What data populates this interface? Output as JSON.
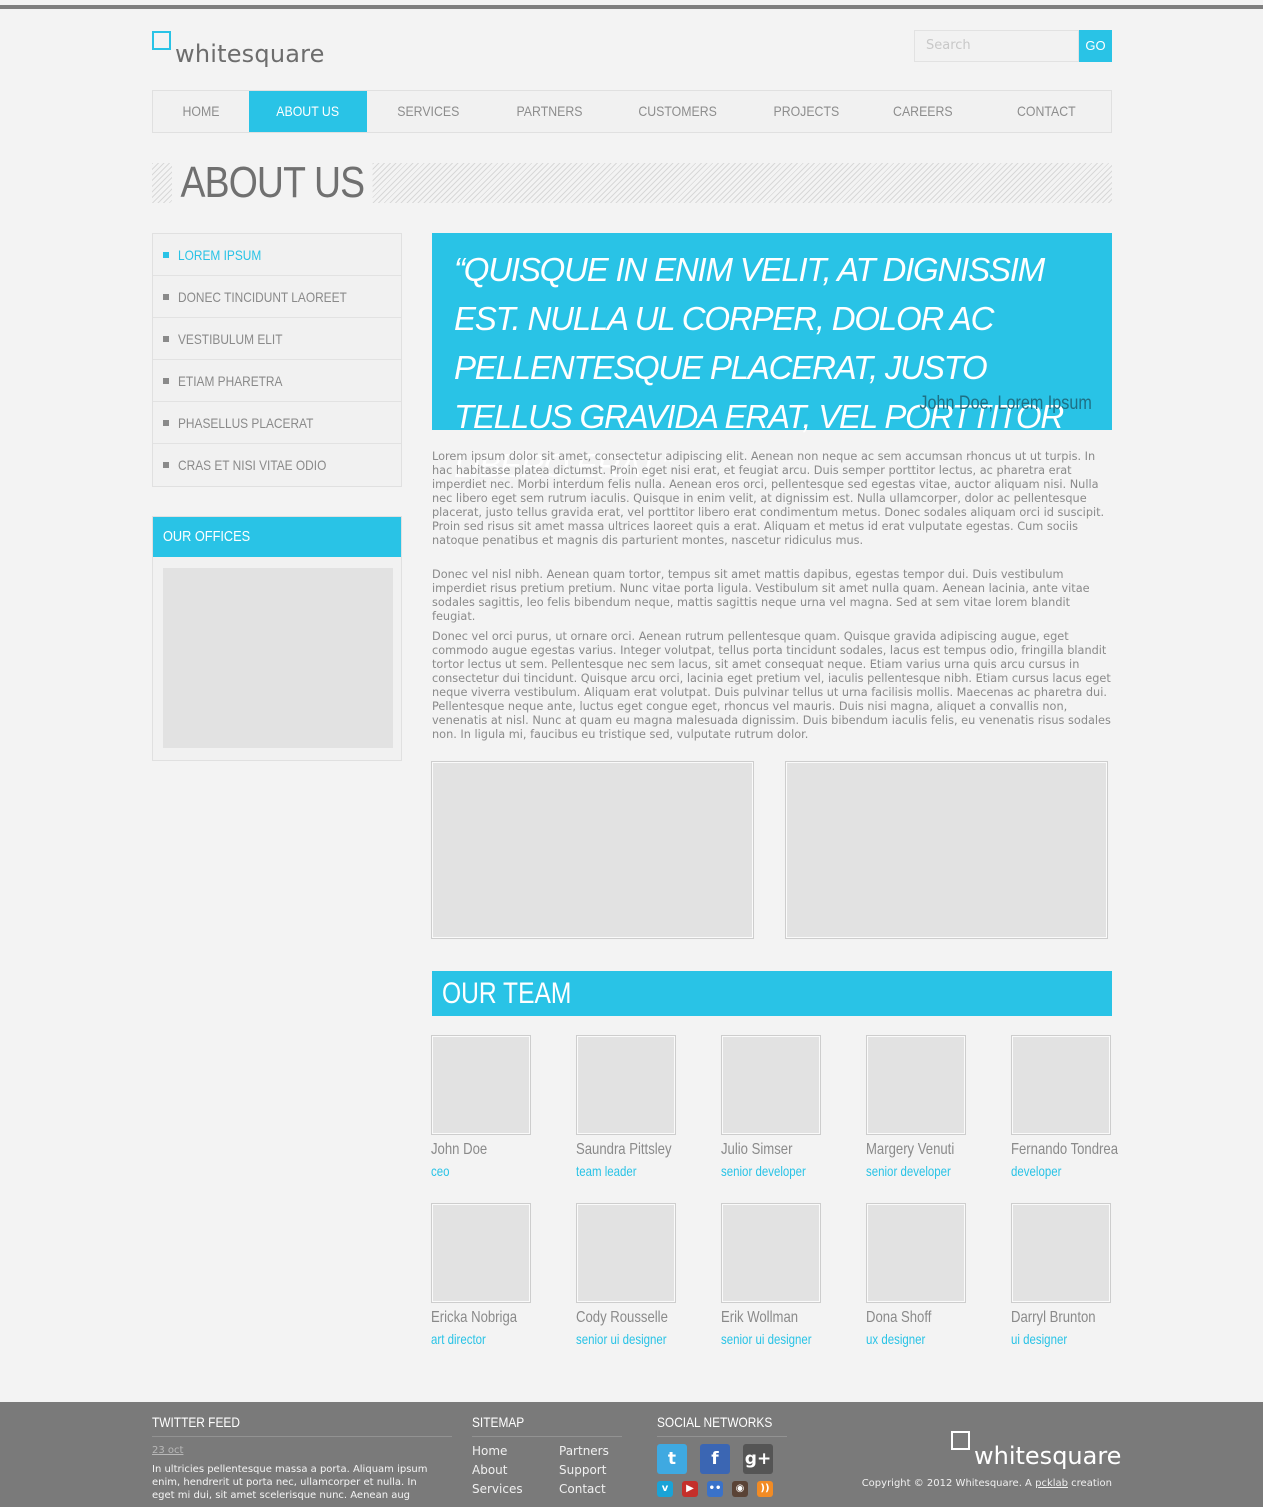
{
  "header": {
    "logo_text": "whitesquare",
    "search_placeholder": "Search",
    "search_button": "GO"
  },
  "nav": [
    {
      "label": "HOME",
      "active": false
    },
    {
      "label": "ABOUT US",
      "active": true
    },
    {
      "label": "SERVICES",
      "active": false
    },
    {
      "label": "PARTNERS",
      "active": false
    },
    {
      "label": "CUSTOMERS",
      "active": false
    },
    {
      "label": "PROJECTS",
      "active": false
    },
    {
      "label": "CAREERS",
      "active": false
    },
    {
      "label": "CONTACT",
      "active": false
    }
  ],
  "page_title": "ABOUT US",
  "sidebar": {
    "items": [
      {
        "label": "LOREM IPSUM",
        "active": true
      },
      {
        "label": "DONEC TINCIDUNT LAOREET",
        "active": false
      },
      {
        "label": "VESTIBULUM ELIT",
        "active": false
      },
      {
        "label": "ETIAM PHARETRA",
        "active": false
      },
      {
        "label": "PHASELLUS PLACERAT",
        "active": false
      },
      {
        "label": "CRAS ET NISI VITAE ODIO",
        "active": false
      }
    ],
    "offices_title": "OUR OFFICES"
  },
  "quote": {
    "text": "“Quisque in enim velit, at dignissim est. nulla ul corper, dolor ac pellentesque placerat, justo tellus gravida erat, vel porttitor libero erat.”",
    "author": "John Doe, Lorem Ipsum"
  },
  "paragraphs": [
    "Lorem ipsum dolor sit amet, consectetur adipiscing elit. Aenean non neque ac sem accumsan rhoncus ut ut turpis. In hac habitasse platea dictumst. Proin eget nisi erat, et feugiat arcu. Duis semper porttitor lectus, ac pharetra erat imperdiet nec. Morbi interdum felis nulla. Aenean eros orci, pellentesque sed egestas vitae, auctor aliquam nisi. Nulla nec libero eget sem rutrum iaculis. Quisque in enim velit, at dignissim est. Nulla ullamcorper, dolor ac pellentesque placerat, justo tellus gravida erat, vel porttitor libero erat condimentum metus. Donec sodales aliquam orci id suscipit. Proin sed risus sit amet massa ultrices laoreet quis a erat. Aliquam et metus id erat vulputate egestas. Cum sociis natoque penatibus et magnis dis parturient montes, nascetur ridiculus mus.",
    "Donec vel nisl nibh. Aenean quam tortor, tempus sit amet mattis dapibus, egestas tempor dui. Duis vestibulum imperdiet risus pretium pretium. Nunc vitae porta ligula. Vestibulum sit amet nulla quam. Aenean lacinia, ante vitae sodales sagittis, leo felis bibendum neque, mattis sagittis neque urna vel magna. Sed at sem vitae lorem blandit feugiat.",
    "Donec vel orci purus, ut ornare orci. Aenean rutrum pellentesque quam. Quisque gravida adipiscing augue, eget commodo augue egestas varius. Integer volutpat, tellus porta tincidunt sodales, lacus est tempus odio, fringilla blandit tortor lectus ut sem. Pellentesque nec sem lacus, sit amet consequat neque. Etiam varius urna quis arcu cursus in consectetur dui tincidunt. Quisque arcu orci, lacinia eget pretium vel, iaculis pellentesque nibh. Etiam cursus lacus eget neque viverra vestibulum. Aliquam erat volutpat. Duis pulvinar tellus ut urna facilisis mollis. Maecenas ac pharetra dui. Pellentesque neque ante, luctus eget congue eget, rhoncus vel mauris. Duis nisi magna, aliquet a convallis non, venenatis at nisl. Nunc at quam eu magna malesuada dignissim. Duis bibendum iaculis felis, eu venenatis risus sodales non. In ligula mi, faucibus eu tristique sed, vulputate rutrum dolor."
  ],
  "team": {
    "title": "OUR TEAM",
    "members": [
      {
        "name": "John Doe",
        "role": "ceo"
      },
      {
        "name": "Saundra Pittsley",
        "role": "team leader"
      },
      {
        "name": "Julio Simser",
        "role": "senior developer"
      },
      {
        "name": "Margery Venuti",
        "role": "senior developer"
      },
      {
        "name": "Fernando Tondrea",
        "role": "developer"
      },
      {
        "name": "Ericka Nobriga",
        "role": "art director"
      },
      {
        "name": "Cody Rousselle",
        "role": "senior ui designer"
      },
      {
        "name": "Erik Wollman",
        "role": "senior ui designer"
      },
      {
        "name": "Dona Shoff",
        "role": "ux designer"
      },
      {
        "name": "Darryl Brunton",
        "role": "ui designer"
      }
    ]
  },
  "footer": {
    "twitter_title": "TWITTER FEED",
    "tweet_date": "23 oct",
    "tweet_text": "In ultricies pellentesque massa a porta. Aliquam ipsum enim, hendrerit ut porta nec, ullamcorper et nulla. In eget mi dui, sit amet scelerisque nunc. Aenean aug",
    "sitemap_title": "SITEMAP",
    "sitemap_links": [
      "Home",
      "About",
      "Services",
      "Partners",
      "Support",
      "Contact"
    ],
    "social_title": "SOCIAL NETWORKS",
    "social_big": [
      {
        "icon": "twitter-icon",
        "glyph": "t",
        "color": "#3fa9e1"
      },
      {
        "icon": "facebook-icon",
        "glyph": "f",
        "color": "#3b66b3"
      },
      {
        "icon": "google-plus-icon",
        "glyph": "g+",
        "color": "#555555"
      }
    ],
    "social_small": [
      {
        "icon": "vimeo-icon",
        "glyph": "v",
        "color": "#1aa3d7"
      },
      {
        "icon": "youtube-icon",
        "glyph": "▶",
        "color": "#c4302b"
      },
      {
        "icon": "flickr-icon",
        "glyph": "••",
        "color": "#3a72c9"
      },
      {
        "icon": "instagram-icon",
        "glyph": "◉",
        "color": "#5a4336"
      },
      {
        "icon": "rss-icon",
        "glyph": "))",
        "color": "#f28b24"
      }
    ],
    "logo_text": "whitesquare",
    "copyright_prefix": "Copyright © 2012 Whitesquare. A",
    "copyright_link": "pcklab",
    "copyright_suffix": "creation"
  },
  "colors": {
    "accent": "#29c3e6",
    "footer_bg": "#7a7a7a",
    "text": "#8a8a8a"
  }
}
